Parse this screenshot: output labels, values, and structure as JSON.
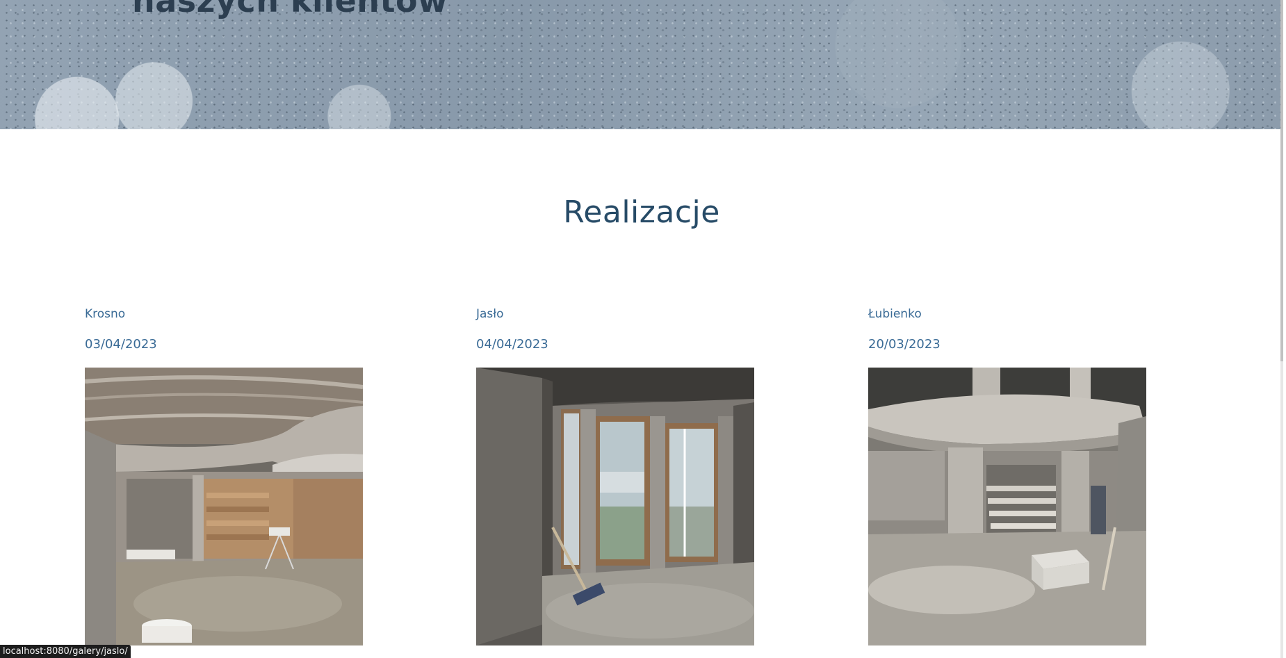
{
  "hero": {
    "title_fragment": "naszych klientów"
  },
  "section": {
    "title": "Realizacje"
  },
  "gallery": [
    {
      "name": "Krosno",
      "date": "03/04/2023",
      "photo": "interior-room-plastered-ceiling"
    },
    {
      "name": "Jasło",
      "date": "04/04/2023",
      "photo": "interior-bay-windows"
    },
    {
      "name": "Łubienko",
      "date": "20/03/2023",
      "photo": "interior-staircase-gallery"
    }
  ],
  "statusbar": {
    "url": "localhost:8080/galery/jaslo/"
  }
}
